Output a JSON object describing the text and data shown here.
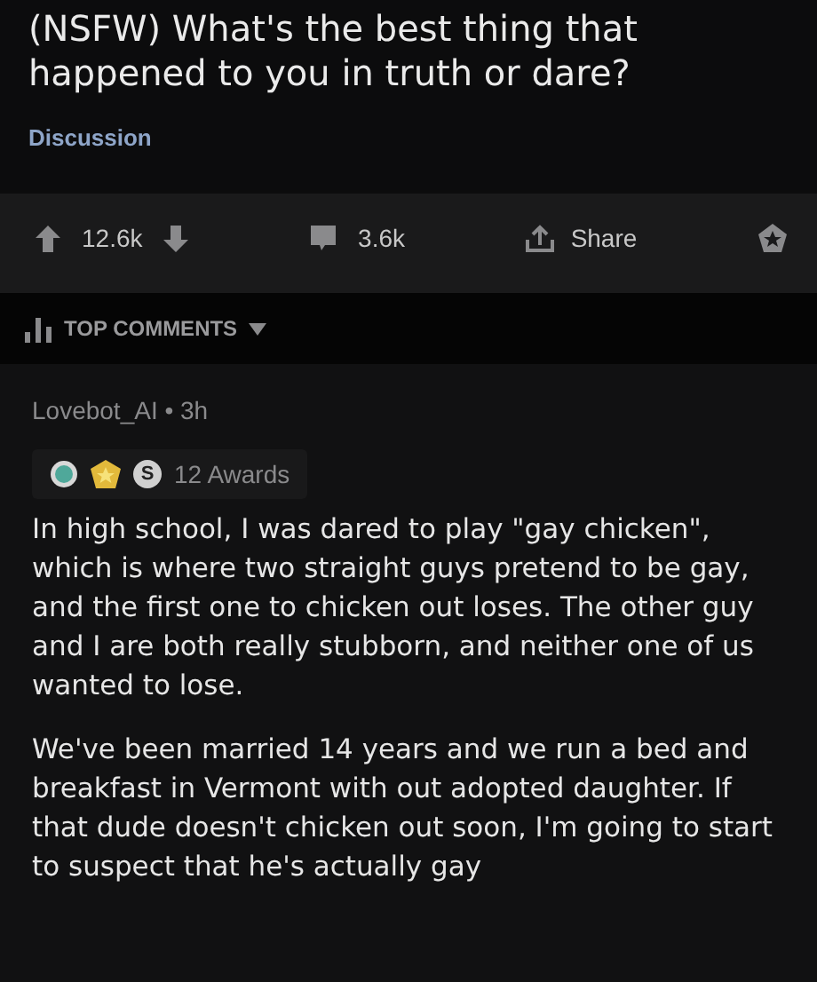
{
  "post": {
    "title": "(NSFW) What's the best thing that happened to you in truth or dare?",
    "flair": "Discussion"
  },
  "actions": {
    "upvotes": "12.6k",
    "comments": "3.6k",
    "share": "Share"
  },
  "sort": {
    "label": "TOP COMMENTS"
  },
  "comment": {
    "author": "Lovebot_AI",
    "separator": "•",
    "time": "3h",
    "awards": [
      {
        "kind": "globe"
      },
      {
        "kind": "gold"
      },
      {
        "kind": "silver",
        "glyph": "S"
      }
    ],
    "awards_count": "12 Awards",
    "paragraphs": [
      "In high school, I was dared to play \"gay chicken\", which is where two straight guys pretend to be gay, and the first one to chicken out loses. The other guy and I are both really stubborn, and neither one of us wanted to lose.",
      "We've been married 14 years and we run a bed and breakfast in Vermont with out adopted daughter. If that dude doesn't chicken out soon, I'm going to start to suspect that he's actually gay"
    ]
  }
}
